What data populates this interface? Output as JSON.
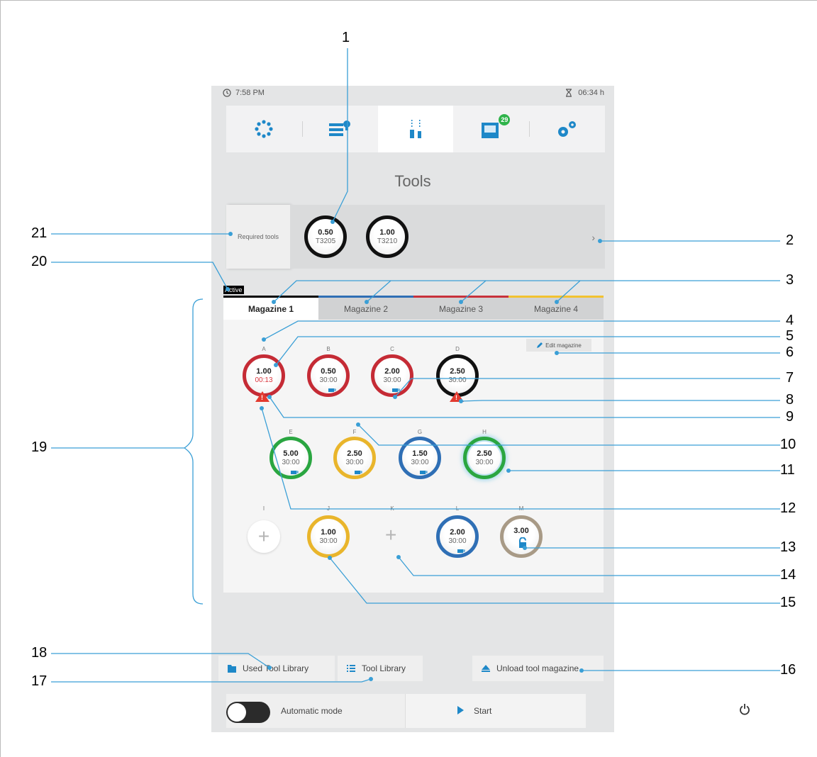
{
  "status": {
    "clock": "7:58 PM",
    "timer": "06:34 h"
  },
  "nav": {
    "items": [
      {
        "icon": "process-dots-icon"
      },
      {
        "icon": "job-list-icon"
      },
      {
        "icon": "tools-icon"
      },
      {
        "icon": "messages-icon",
        "badge": "29"
      },
      {
        "icon": "settings-gears-icon"
      }
    ]
  },
  "title": "Tools",
  "required": {
    "label": "Required tools",
    "tools": [
      {
        "diameter": "0.50",
        "id": "T3205"
      },
      {
        "diameter": "1.00",
        "id": "T3210"
      }
    ],
    "next_icon": "chevron-right-icon"
  },
  "active_label": "Active",
  "magazine": {
    "tabs": [
      {
        "label": "Magazine 1",
        "color": "#000000"
      },
      {
        "label": "Magazine 2",
        "color": "#2f6fb5"
      },
      {
        "label": "Magazine 3",
        "color": "#c8323c"
      },
      {
        "label": "Magazine 4",
        "color": "#f2c230"
      }
    ],
    "edit_label": "Edit magazine",
    "slots": [
      {
        "letter": "A",
        "diameter": "1.00",
        "life": "00:13",
        "ring": "#c52b35",
        "critical": true,
        "warning": true,
        "cup": false
      },
      {
        "letter": "B",
        "diameter": "0.50",
        "life": "30:00",
        "ring": "#c52b35",
        "cup": true
      },
      {
        "letter": "C",
        "diameter": "2.00",
        "life": "30:00",
        "ring": "#c52b35",
        "cup": true
      },
      {
        "letter": "D",
        "diameter": "2.50",
        "life": "30:00",
        "ring": "#111111",
        "warning": true,
        "cup": false
      },
      {
        "letter": "E",
        "diameter": "5.00",
        "life": "30:00",
        "ring": "#2aa641",
        "cup": true
      },
      {
        "letter": "F",
        "diameter": "2.50",
        "life": "30:00",
        "ring": "#e9b52b",
        "cup": true
      },
      {
        "letter": "G",
        "diameter": "1.50",
        "life": "30:00",
        "ring": "#2f6fb5",
        "cup": true
      },
      {
        "letter": "H",
        "diameter": "2.50",
        "life": "30:00",
        "ring": "#2aa641",
        "glow": true,
        "cup": false
      },
      {
        "letter": "I",
        "empty": true
      },
      {
        "letter": "J",
        "diameter": "1.00",
        "life": "30:00",
        "ring": "#e9b52b",
        "cup": false
      },
      {
        "letter": "K",
        "empty": true
      },
      {
        "letter": "L",
        "diameter": "2.00",
        "life": "30:00",
        "ring": "#2f6fb5",
        "cup": true
      },
      {
        "letter": "M",
        "diameter": "3.00",
        "ring": "#a89a86",
        "locked": true
      }
    ]
  },
  "buttons": {
    "used_library": "Used Tool Library",
    "tool_library": "Tool Library",
    "unload": "Unload tool magazine"
  },
  "bottom": {
    "automatic_mode": "Automatic mode",
    "start": "Start"
  },
  "callouts": [
    "1",
    "2",
    "3",
    "4",
    "5",
    "6",
    "7",
    "8",
    "9",
    "10",
    "11",
    "12",
    "13",
    "14",
    "15",
    "16",
    "17",
    "18",
    "19",
    "20",
    "21"
  ],
  "colors": {
    "accent": "#1e88c8",
    "badge": "#2fb34a",
    "warning": "#e23a2f"
  }
}
